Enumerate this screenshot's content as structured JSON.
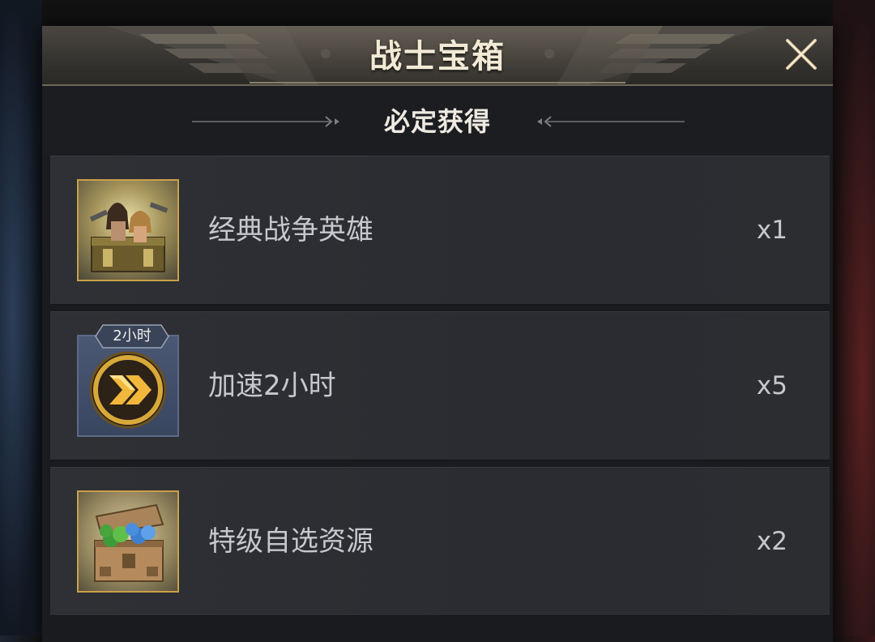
{
  "dialog": {
    "title": "战士宝箱",
    "subtitle": "必定获得"
  },
  "items": [
    {
      "name": "经典战争英雄",
      "quantity": "x1",
      "icon": "hero-crate-icon"
    },
    {
      "name": "加速2小时",
      "quantity": "x5",
      "icon": "speedup-icon",
      "badge": "2小时"
    },
    {
      "name": "特级自选资源",
      "quantity": "x2",
      "icon": "resource-chest-icon"
    }
  ],
  "colors": {
    "title": "#f3ead6",
    "text": "#c7c8cc",
    "gold": "#d8a93a",
    "panel": "#1a1b1e"
  }
}
